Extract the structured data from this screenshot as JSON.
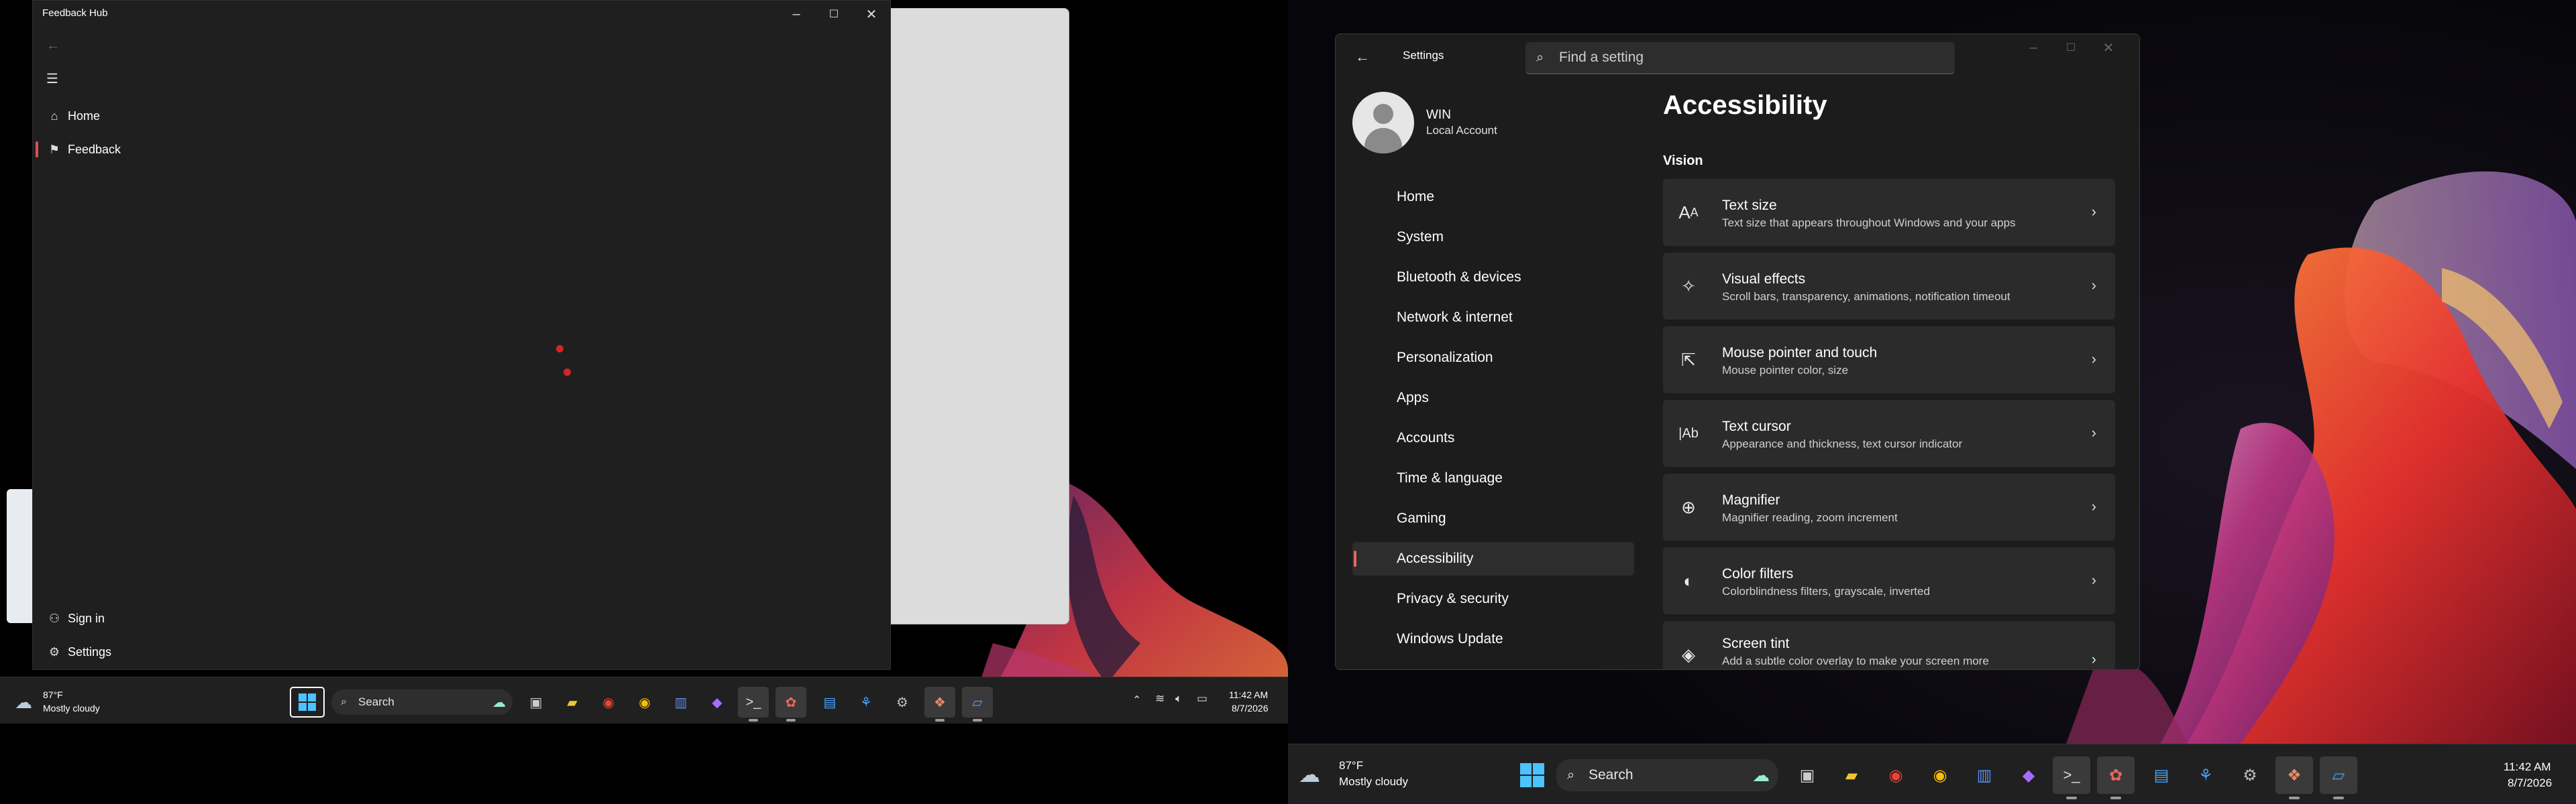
{
  "left_monitor": {
    "feedback_hub": {
      "title": "Feedback Hub",
      "nav": [
        {
          "icon": "home-icon",
          "label": "Home"
        },
        {
          "icon": "feedback-icon",
          "label": "Feedback"
        }
      ],
      "footer_nav": [
        {
          "icon": "person-icon",
          "label": "Sign in"
        },
        {
          "icon": "gear-icon",
          "label": "Settings"
        }
      ]
    },
    "taskbar": {
      "weather_temp": "87°F",
      "weather_desc": "Mostly cloudy",
      "search_label": "Search",
      "clock_time": "11:42 AM",
      "clock_date": "8/7/2026"
    }
  },
  "right_monitor": {
    "settings": {
      "title": "Settings",
      "search_placeholder": "Find a setting",
      "user": {
        "name": "WIN",
        "account_type": "Local Account"
      },
      "nav": [
        "Home",
        "System",
        "Bluetooth & devices",
        "Network & internet",
        "Personalization",
        "Apps",
        "Accounts",
        "Time & language",
        "Gaming",
        "Accessibility",
        "Privacy & security",
        "Windows Update"
      ],
      "active_nav": "Accessibility",
      "page_title": "Accessibility",
      "section": "Vision",
      "cards": [
        {
          "icon": "text-size-icon",
          "title": "Text size",
          "subtitle": "Text size that appears throughout Windows and your apps"
        },
        {
          "icon": "visual-effects-icon",
          "title": "Visual effects",
          "subtitle": "Scroll bars, transparency, animations, notification timeout"
        },
        {
          "icon": "mouse-pointer-icon",
          "title": "Mouse pointer and touch",
          "subtitle": "Mouse pointer color, size"
        },
        {
          "icon": "text-cursor-icon",
          "title": "Text cursor",
          "subtitle": "Appearance and thickness, text cursor indicator"
        },
        {
          "icon": "magnifier-icon",
          "title": "Magnifier",
          "subtitle": "Magnifier reading, zoom increment"
        },
        {
          "icon": "color-filters-icon",
          "title": "Color filters",
          "subtitle": "Colorblindness filters, grayscale, inverted"
        },
        {
          "icon": "screen-tint-icon",
          "title": "Screen tint",
          "subtitle": "Add a subtle color overlay to make your screen more"
        }
      ]
    },
    "taskbar": {
      "weather_temp": "87°F",
      "weather_desc": "Mostly cloudy",
      "search_label": "Search",
      "clock_time": "11:42 AM",
      "clock_date": "8/7/2026"
    }
  },
  "colors": {
    "accent": "#e8685a",
    "window_bg": "#1c1c1c",
    "card_bg": "#2b2b2b",
    "taskbar_bg": "#202020"
  }
}
